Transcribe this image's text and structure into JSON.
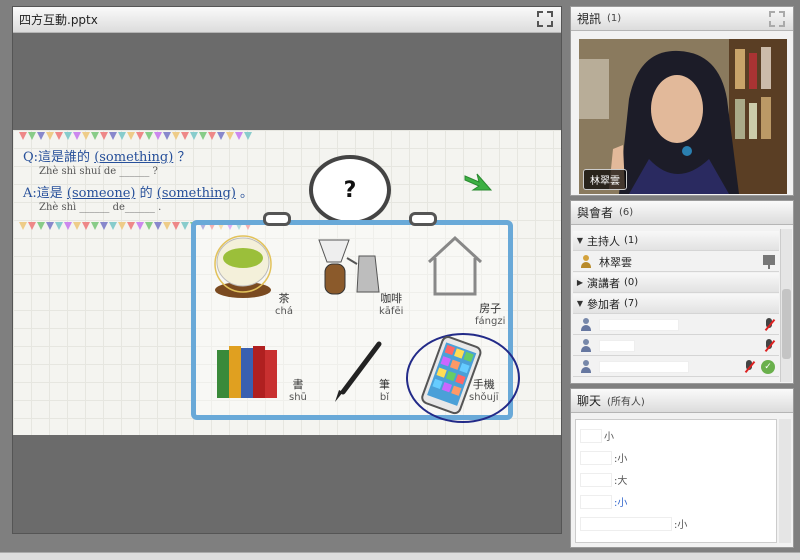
{
  "presentation": {
    "title": "四方互動.pptx",
    "slide": {
      "question": {
        "prefix": "Q:這是誰的",
        "blank": "(something)",
        "suffix": "？"
      },
      "question_pinyin": "Zhè shì shuí de ______ ?",
      "answer": {
        "prefix": "A:這是",
        "blank1": "(someone)",
        "mid": "的",
        "blank2": "(something)",
        "suffix": "。"
      },
      "answer_pinyin": "Zhè shì ______ de______ .",
      "bubble_mark": "?",
      "items": [
        {
          "hanzi": "茶",
          "pinyin": "chá"
        },
        {
          "hanzi": "咖啡",
          "pinyin": "kāfēi"
        },
        {
          "hanzi": "房子",
          "pinyin": "fángzi"
        },
        {
          "hanzi": "書",
          "pinyin": "shū"
        },
        {
          "hanzi": "筆",
          "pinyin": "bǐ"
        },
        {
          "hanzi": "手機",
          "pinyin": "shǒujī"
        }
      ]
    }
  },
  "video": {
    "title": "視訊",
    "count": "(1)",
    "presenter_name": "林翠雲"
  },
  "attendees": {
    "title": "與會者",
    "count": "(6)",
    "sections": [
      {
        "label": "主持人",
        "count": "(1)"
      },
      {
        "label": "演講者",
        "count": "(0)"
      },
      {
        "label": "參加者",
        "count": "(7)"
      }
    ],
    "host_name": "林翠雲"
  },
  "chat": {
    "title": "聊天",
    "scope": "(所有人)",
    "messages": [
      {
        "text": "小"
      },
      {
        "text": ":小"
      },
      {
        "text": ":大"
      },
      {
        "text": ":小"
      },
      {
        "text": ":小"
      }
    ]
  },
  "colors": {
    "accent_blue": "#27509a",
    "frame_blue": "#69a9d8",
    "mute_red": "#d22222"
  }
}
